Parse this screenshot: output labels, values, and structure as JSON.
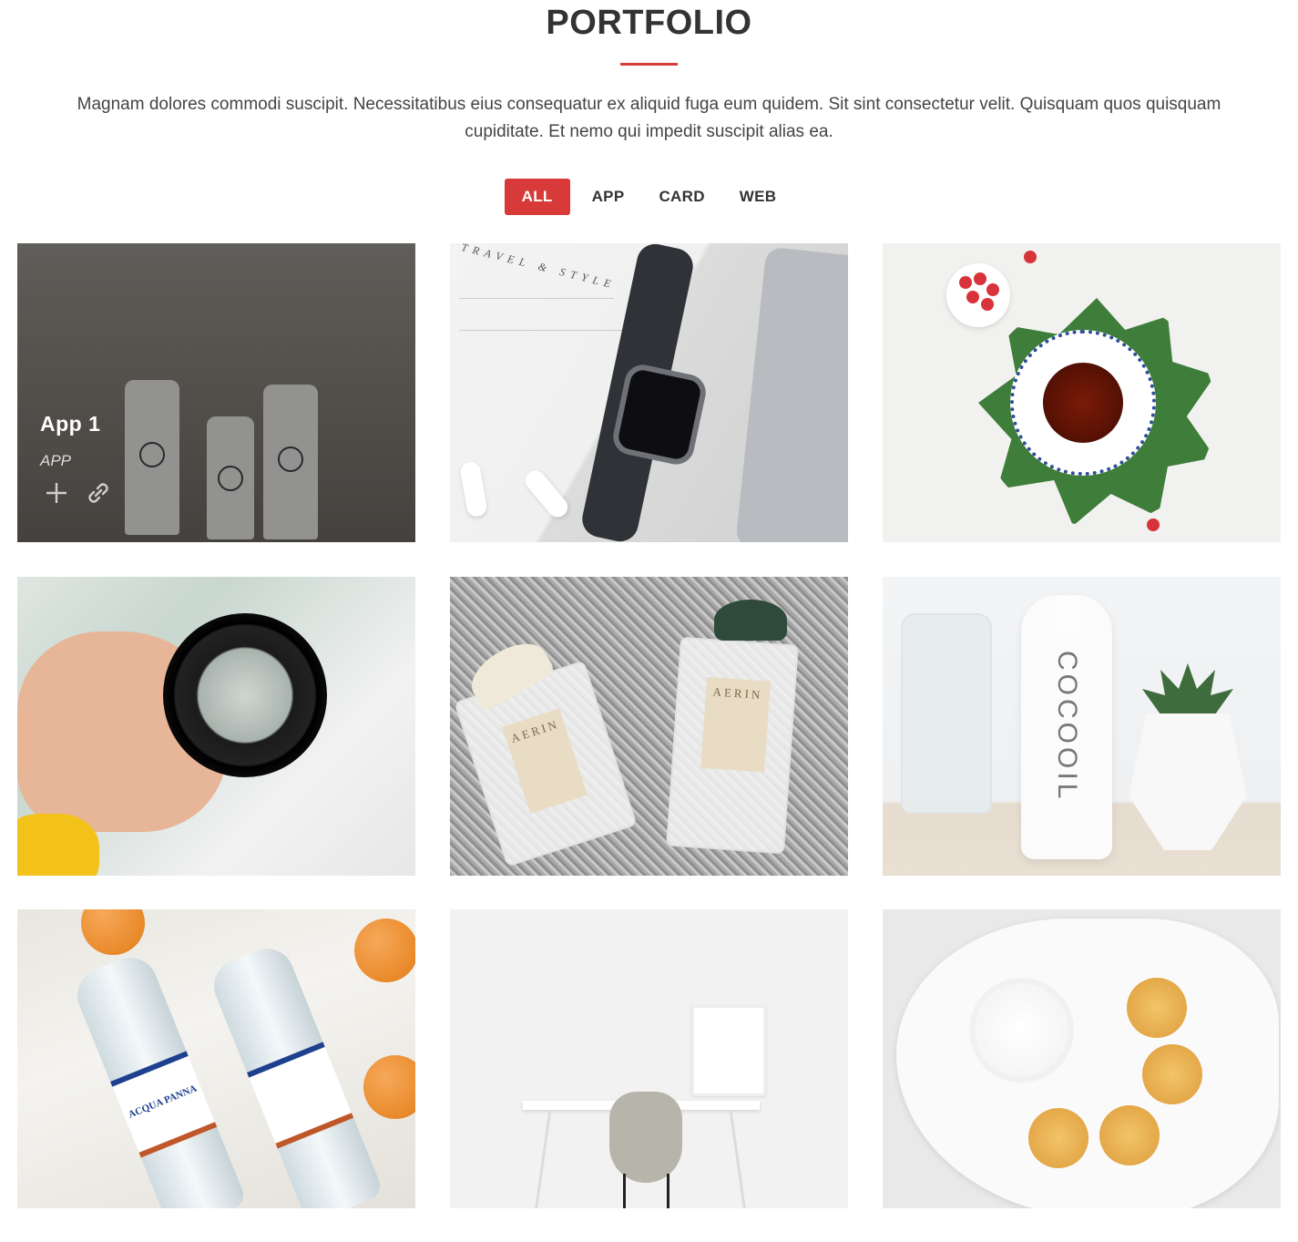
{
  "section": {
    "title": "PORTFOLIO",
    "intro": "Magnam dolores commodi suscipit. Necessitatibus eius consequatur ex aliquid fuga eum quidem. Sit sint consectetur velit. Quisquam quos quisquam cupiditate. Et nemo qui impedit suscipit alias ea."
  },
  "filters": [
    {
      "label": "ALL",
      "active": true
    },
    {
      "label": "APP",
      "active": false
    },
    {
      "label": "CARD",
      "active": false
    },
    {
      "label": "WEB",
      "active": false
    }
  ],
  "portfolio": {
    "hovered_item": {
      "title": "App 1",
      "category": "APP",
      "icons": [
        "plus-icon",
        "link-icon"
      ]
    },
    "items": [
      {
        "image": "basket-and-bottles-image"
      },
      {
        "image": "smartwatch-and-laptop-image"
      },
      {
        "image": "tea-cup-and-raspberries-image"
      },
      {
        "image": "camera-lens-in-hand-image"
      },
      {
        "image": "aerin-perfume-bottles-image"
      },
      {
        "image": "cocooil-bottle-and-plant-image"
      },
      {
        "image": "acqua-panna-bottles-image"
      },
      {
        "image": "white-desk-and-chair-image"
      },
      {
        "image": "plate-with-cookies-image"
      }
    ]
  },
  "image_text": {
    "magazine": "TRAVEL & STYLE",
    "perfume_left": "AERIN",
    "perfume_right": "AERIN",
    "cocooil": "COCOOIL",
    "water_brand": "ACQUA PANNA"
  },
  "colors": {
    "accent": "#d83a3a",
    "title": "#333333",
    "text": "#444444"
  }
}
